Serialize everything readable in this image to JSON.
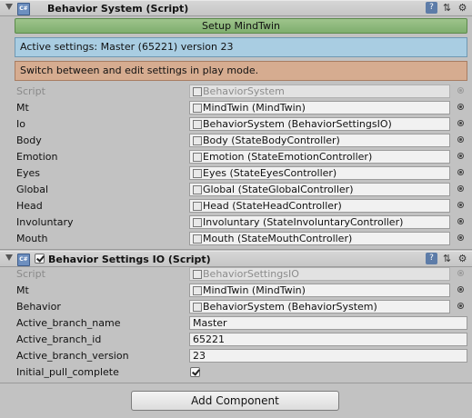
{
  "component1": {
    "title": "Behavior System (Script)",
    "icon_text": "C#",
    "header_icons": [
      "book-icon",
      "preset-icon",
      "gear-icon"
    ],
    "setup_button": "Setup MindTwin",
    "info_active": "Active settings: Master (65221) version 23",
    "info_playmode": "Switch between and edit settings in play mode.",
    "fields": [
      {
        "label": "Script",
        "value": "BehaviorSystem",
        "disabled": true
      },
      {
        "label": "Mt",
        "value": "MindTwin (MindTwin)"
      },
      {
        "label": "Io",
        "value": "BehaviorSystem (BehaviorSettingsIO)"
      },
      {
        "label": "Body",
        "value": "Body (StateBodyController)"
      },
      {
        "label": "Emotion",
        "value": "Emotion (StateEmotionController)"
      },
      {
        "label": "Eyes",
        "value": "Eyes (StateEyesController)"
      },
      {
        "label": "Global",
        "value": "Global (StateGlobalController)"
      },
      {
        "label": "Head",
        "value": "Head (StateHeadController)"
      },
      {
        "label": "Involuntary",
        "value": "Involuntary (StateInvoluntaryController)"
      },
      {
        "label": "Mouth",
        "value": "Mouth (StateMouthController)"
      }
    ]
  },
  "component2": {
    "title": "Behavior Settings IO (Script)",
    "icon_text": "C#",
    "enabled": true,
    "fields": [
      {
        "label": "Script",
        "value": "BehaviorSettingsIO",
        "disabled": true
      },
      {
        "label": "Mt",
        "value": "MindTwin (MindTwin)"
      },
      {
        "label": "Behavior",
        "value": "BehaviorSystem (BehaviorSystem)"
      }
    ],
    "text_fields": [
      {
        "label": "Active_branch_name",
        "value": "Master"
      },
      {
        "label": "Active_branch_id",
        "value": "65221"
      },
      {
        "label": "Active_branch_version",
        "value": "23"
      }
    ],
    "toggle": {
      "label": "Initial_pull_complete",
      "checked": true
    }
  },
  "add_component_label": "Add Component"
}
